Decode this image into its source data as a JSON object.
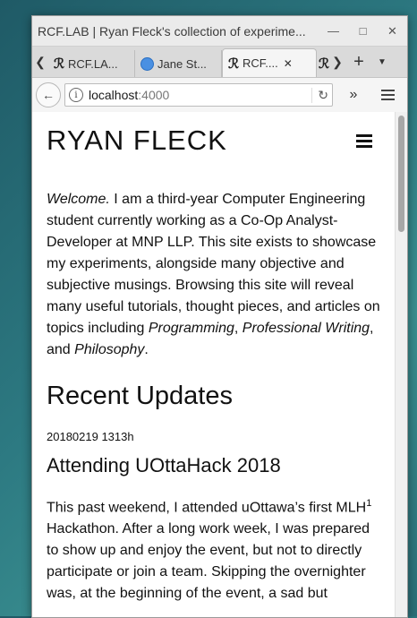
{
  "window": {
    "title": "RCF.LAB | Ryan Fleck's collection of experime...",
    "controls": [
      "minimize-icon",
      "maximize-icon",
      "close-icon"
    ]
  },
  "tabs": [
    {
      "label": "RCF.LA...",
      "icon": "R"
    },
    {
      "label": "Jane St...",
      "icon": "globe"
    },
    {
      "label": "RCF....",
      "icon": "R",
      "active": true
    },
    {
      "label": "",
      "icon": "R"
    }
  ],
  "toolbar": {
    "url_host": "localhost",
    "url_port": ":4000"
  },
  "page": {
    "site_title": "RYAN FLECK",
    "intro": {
      "welcome": "Welcome.",
      "text1": " I am a third-year Computer Engineering student currently working as a Co-Op Analyst-Developer at MNP LLP. This site exists to showcase my experiments, alongside many objective and subjective musings. Browsing this site will reveal many useful tutorials, thought pieces, and articles on topics including ",
      "topic1": "Programming",
      "sep1": ", ",
      "topic2": "Professional Writing",
      "sep2": ", and ",
      "topic3": "Philosophy",
      "end": "."
    },
    "section_title": "Recent Updates",
    "post": {
      "date": "20180219 1313h",
      "title": "Attending UOttaHack 2018",
      "body1": "This past weekend, I attended uOttawa’s first MLH",
      "footnote": "1",
      "body2": " Hackathon. After a long work week, I was prepared to show up and enjoy the event, but not to directly participate or join a team. Skipping the overnighter was, at the beginning of the event, a sad but"
    }
  }
}
